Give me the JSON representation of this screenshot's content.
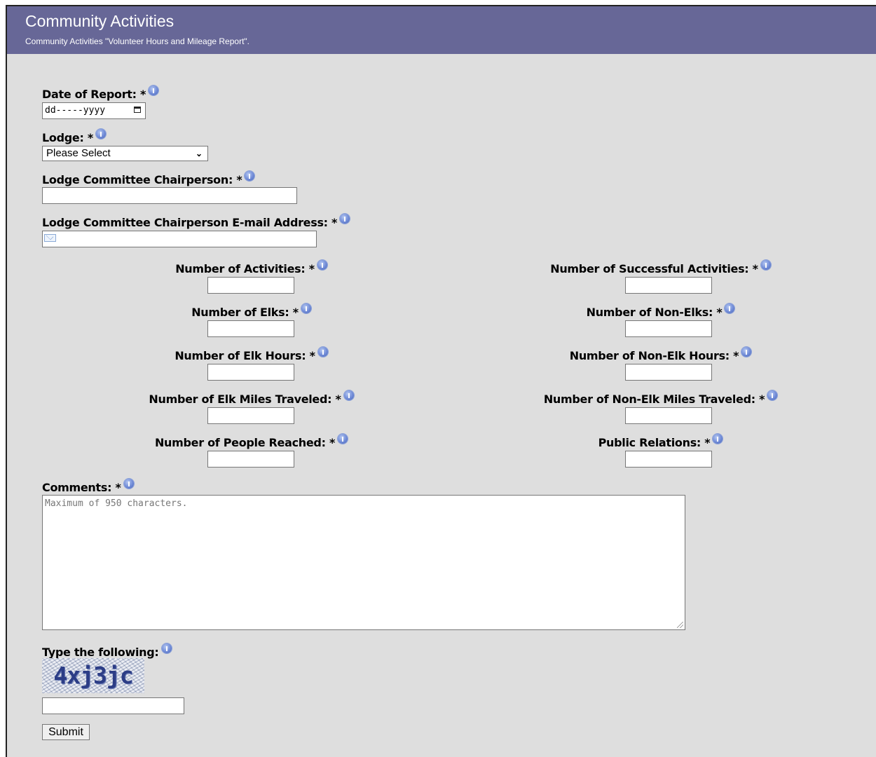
{
  "header": {
    "title": "Community Activities",
    "subtitle": "Community Activities \"Volunteer Hours and Mileage Report\"."
  },
  "form": {
    "date_of_report": {
      "label": "Date of Report: *",
      "placeholder": "dd-----yyyy"
    },
    "lodge": {
      "label": "Lodge: *",
      "selected": "Please Select"
    },
    "chairperson": {
      "label": "Lodge Committee Chairperson: *",
      "value": ""
    },
    "chairperson_email": {
      "label": "Lodge Committee Chairperson E-mail Address: *",
      "value": ""
    },
    "number_of_activities": {
      "label": "Number of Activities: *",
      "value": ""
    },
    "number_of_successful_activities": {
      "label": "Number of Successful Activities: *",
      "value": ""
    },
    "number_of_elks": {
      "label": "Number of Elks: *",
      "value": ""
    },
    "number_of_non_elks": {
      "label": "Number of Non-Elks: *",
      "value": ""
    },
    "number_of_elk_hours": {
      "label": "Number of Elk Hours: *",
      "value": ""
    },
    "number_of_non_elk_hours": {
      "label": "Number of Non-Elk Hours: *",
      "value": ""
    },
    "number_of_elk_miles": {
      "label": "Number of Elk Miles Traveled: *",
      "value": ""
    },
    "number_of_non_elk_miles": {
      "label": "Number of Non-Elk Miles Traveled: *",
      "value": ""
    },
    "number_of_people_reached": {
      "label": "Number of People Reached: *",
      "value": ""
    },
    "public_relations": {
      "label": "Public Relations: *",
      "value": ""
    },
    "comments": {
      "label": "Comments: *",
      "placeholder": "Maximum of 950 characters."
    },
    "captcha": {
      "label": "Type the following:",
      "image_text": "4xj3jc",
      "value": ""
    },
    "submit_label": "Submit"
  },
  "colors": {
    "header_bg": "#676797",
    "page_bg": "#dedede",
    "info_icon": "#6f8ad6"
  }
}
